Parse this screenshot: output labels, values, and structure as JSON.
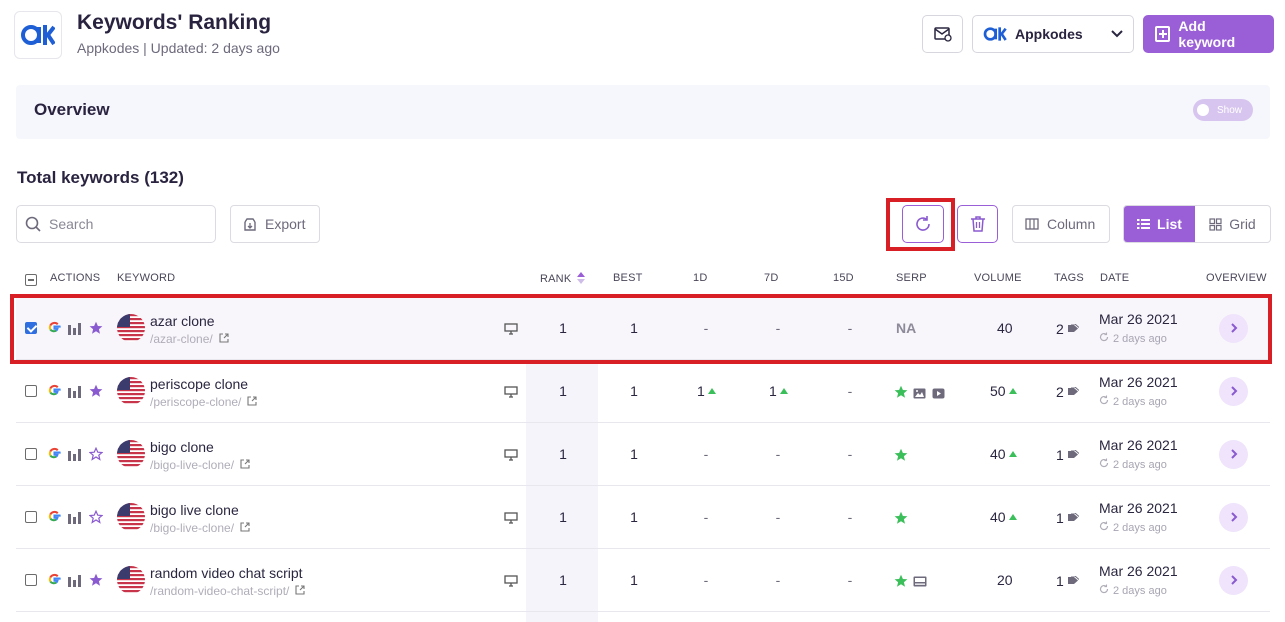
{
  "header": {
    "title": "Keywords' Ranking",
    "subtitle": "Appkodes | Updated: 2 days ago",
    "project": "Appkodes",
    "add_keyword_label": "Add keyword"
  },
  "overview": {
    "label": "Overview",
    "toggle_label": "Show"
  },
  "total_label": "Total keywords (132)",
  "toolbar": {
    "search_placeholder": "Search",
    "export_label": "Export",
    "column_label": "Column",
    "list_label": "List",
    "grid_label": "Grid"
  },
  "table": {
    "headers": {
      "actions": "ACTIONS",
      "keyword": "KEYWORD",
      "rank": "RANK",
      "best": "BEST",
      "d1": "1D",
      "d7": "7D",
      "d15": "15D",
      "serp": "SERP",
      "volume": "VOLUME",
      "tags": "TAGS",
      "date": "DATE",
      "overview": "OVERVIEW"
    },
    "rows": [
      {
        "keyword": "azar clone",
        "url": "/azar-clone/",
        "rank": "1",
        "best": "1",
        "d1": "-",
        "d7": "-",
        "d15": "-",
        "serp": "NA",
        "volume": "40",
        "tags": "2",
        "date": "Mar 26 2021",
        "ago": "2 days ago"
      },
      {
        "keyword": "periscope clone",
        "url": "/periscope-clone/",
        "rank": "1",
        "best": "1",
        "d1": "1",
        "d7": "1",
        "d15": "-",
        "serp": "",
        "volume": "50",
        "tags": "2",
        "date": "Mar 26 2021",
        "ago": "2 days ago"
      },
      {
        "keyword": "bigo clone",
        "url": "/bigo-live-clone/",
        "rank": "1",
        "best": "1",
        "d1": "-",
        "d7": "-",
        "d15": "-",
        "serp": "",
        "volume": "40",
        "tags": "1",
        "date": "Mar 26 2021",
        "ago": "2 days ago"
      },
      {
        "keyword": "bigo live clone",
        "url": "/bigo-live-clone/",
        "rank": "1",
        "best": "1",
        "d1": "-",
        "d7": "-",
        "d15": "-",
        "serp": "",
        "volume": "40",
        "tags": "1",
        "date": "Mar 26 2021",
        "ago": "2 days ago"
      },
      {
        "keyword": "random video chat script",
        "url": "/random-video-chat-script/",
        "rank": "1",
        "best": "1",
        "d1": "-",
        "d7": "-",
        "d15": "-",
        "serp": "",
        "volume": "20",
        "tags": "1",
        "date": "Mar 26 2021",
        "ago": "2 days ago"
      }
    ]
  },
  "colors": {
    "accent": "#9a5fd6",
    "highlight": "#d91f26",
    "up": "#3bbf5a"
  }
}
